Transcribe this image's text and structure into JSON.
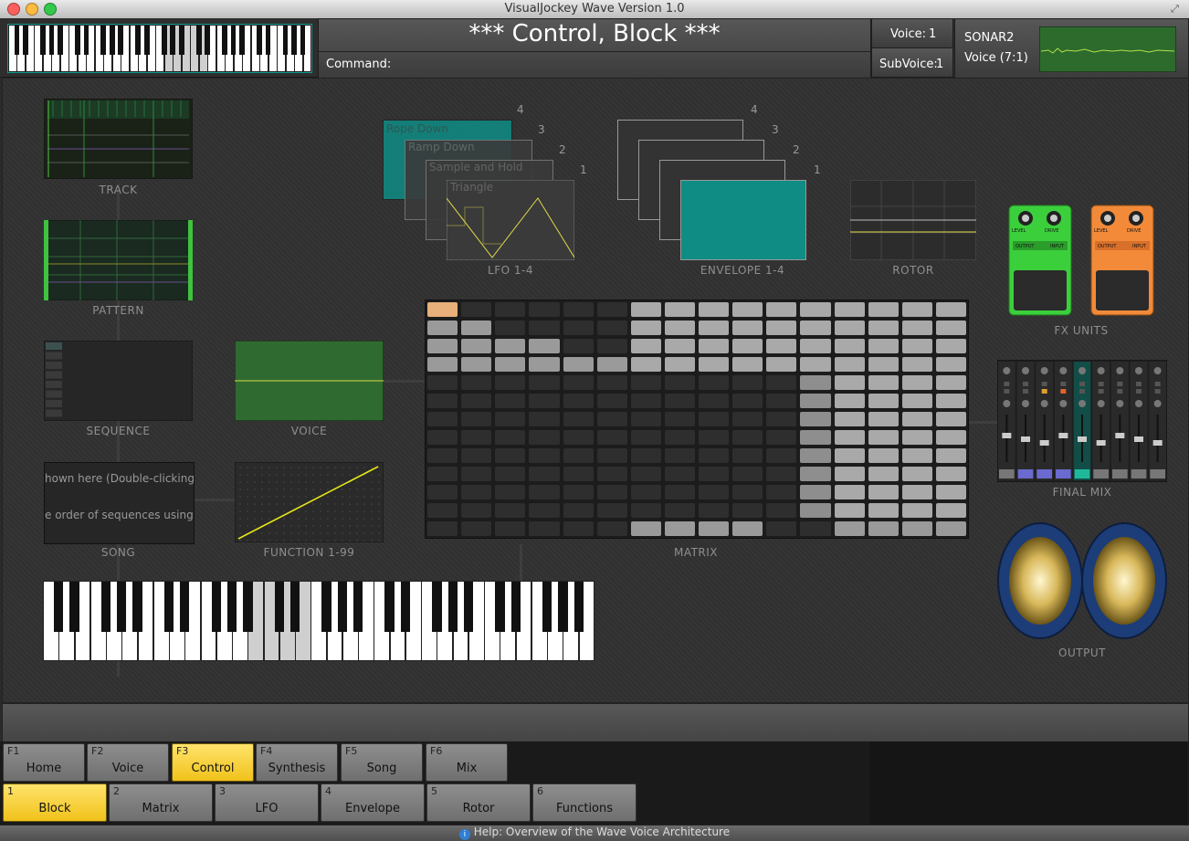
{
  "window": {
    "title": "VisualJockey Wave Version 1.0"
  },
  "header": {
    "title": "*** Control, Block ***",
    "command_label": "Command:",
    "voice_label": "Voice:",
    "voice_value": "1",
    "subvoice_label": "SubVoice:",
    "subvoice_value": "1",
    "sonar_label": "SONAR2",
    "voice_info": "Voice (7:1)"
  },
  "panels": {
    "track": "TRACK",
    "pattern": "PATTERN",
    "sequence": "SEQUENCE",
    "voice": "VOICE",
    "song": "SONG",
    "song_text_1": "hown here (Double-clicking",
    "song_text_2": "e order of sequences using",
    "function": "FUNCTION 1-99",
    "lfo": "LFO 1-4",
    "lfo_cards": [
      "Rope Down",
      "Ramp Down",
      "Sample and Hold",
      "Triangle"
    ],
    "lfo_numbers": [
      "4",
      "3",
      "2",
      "1"
    ],
    "envelope": "ENVELOPE 1-4",
    "envelope_numbers": [
      "4",
      "3",
      "2",
      "1"
    ],
    "rotor": "ROTOR",
    "matrix": "MATRIX",
    "fx_units": "FX UNITS",
    "final_mix": "FINAL MIX",
    "output": "OUTPUT"
  },
  "pedal_labels": {
    "level": "LEVEL",
    "drive": "DRIVE",
    "output": "OUTPUT",
    "input": "INPUT"
  },
  "colors": {
    "accent_yellow": "#f5cc2a",
    "teal": "#0f8c84",
    "voice_green": "#2f6b30",
    "pedal_green": "#3ccf3c",
    "pedal_orange": "#f28a3a"
  },
  "tabs_top": [
    {
      "fn": "F1",
      "label": "Home",
      "active": false
    },
    {
      "fn": "F2",
      "label": "Voice",
      "active": false
    },
    {
      "fn": "F3",
      "label": "Control",
      "active": true
    },
    {
      "fn": "F4",
      "label": "Synthesis",
      "active": false
    },
    {
      "fn": "F5",
      "label": "Song",
      "active": false
    },
    {
      "fn": "F6",
      "label": "Mix",
      "active": false
    }
  ],
  "tabs_bottom": [
    {
      "num": "1",
      "label": "Block",
      "active": true
    },
    {
      "num": "2",
      "label": "Matrix",
      "active": false
    },
    {
      "num": "3",
      "label": "LFO",
      "active": false
    },
    {
      "num": "4",
      "label": "Envelope",
      "active": false
    },
    {
      "num": "5",
      "label": "Rotor",
      "active": false
    },
    {
      "num": "6",
      "label": "Functions",
      "active": false
    }
  ],
  "help": {
    "text": "Help: Overview of the Wave Voice Architecture",
    "icon": "info-icon"
  }
}
